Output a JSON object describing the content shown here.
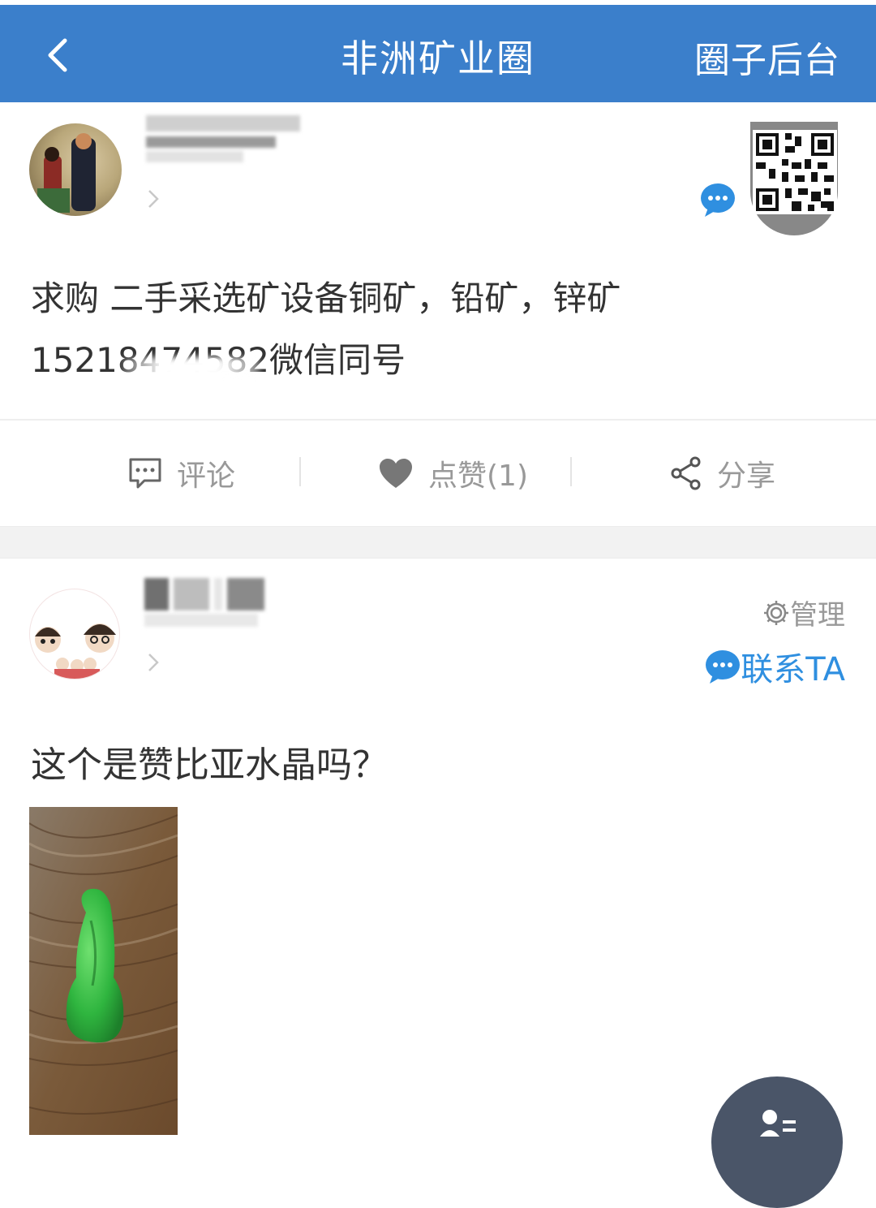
{
  "header": {
    "title": "非洲矿业圈",
    "admin_label": "圈子后台"
  },
  "post1": {
    "text_line1": "求购 二手采选矿设备铜矿，铅矿，锌矿",
    "text_line2": "15218474582微信同号",
    "actions": {
      "comment_label": "评论",
      "like_label": "点赞(1)",
      "share_label": "分享"
    }
  },
  "post2": {
    "manage_label": "管理",
    "contact_label": "联系TA",
    "text": "这个是赞比亚水晶吗？"
  },
  "colors": {
    "header_bg": "#3b7fcb",
    "accent_blue": "#2f8fe0",
    "muted_text": "#999999",
    "body_text": "#333333"
  },
  "icons": [
    "back-arrow-icon",
    "chevron-right-icon",
    "qr-code-icon",
    "chat-bubble-icon",
    "comment-icon",
    "heart-icon",
    "share-icon",
    "gear-icon",
    "user-list-icon"
  ]
}
